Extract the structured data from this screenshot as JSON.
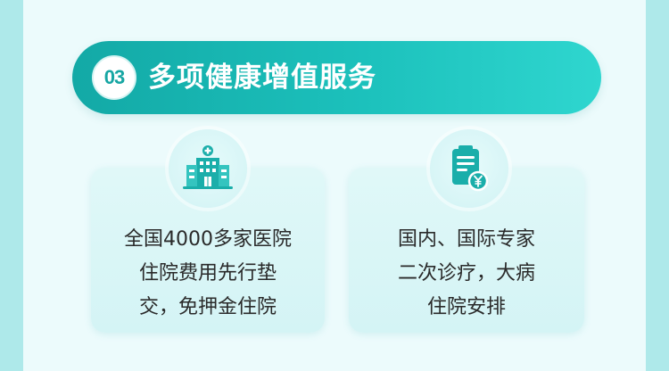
{
  "header": {
    "number": "03",
    "title": "多项健康增值服务"
  },
  "cards": [
    {
      "icon": "hospital-icon",
      "lines": [
        "全国4000多家医院",
        "住院费用先行垫",
        "交，免押金住院"
      ]
    },
    {
      "icon": "clipboard-yuan-icon",
      "lines": [
        "国内、国际专家",
        "二次诊疗，大病",
        "住院安排"
      ]
    }
  ],
  "colors": {
    "accent": "#17a6a3",
    "header_gradient_start": "#13a9a6",
    "header_gradient_end": "#2fd6cf",
    "background": "#aee9ea",
    "panel": "#ecfbfc",
    "card": "#d8f5f6",
    "text": "#2a2a2a"
  }
}
